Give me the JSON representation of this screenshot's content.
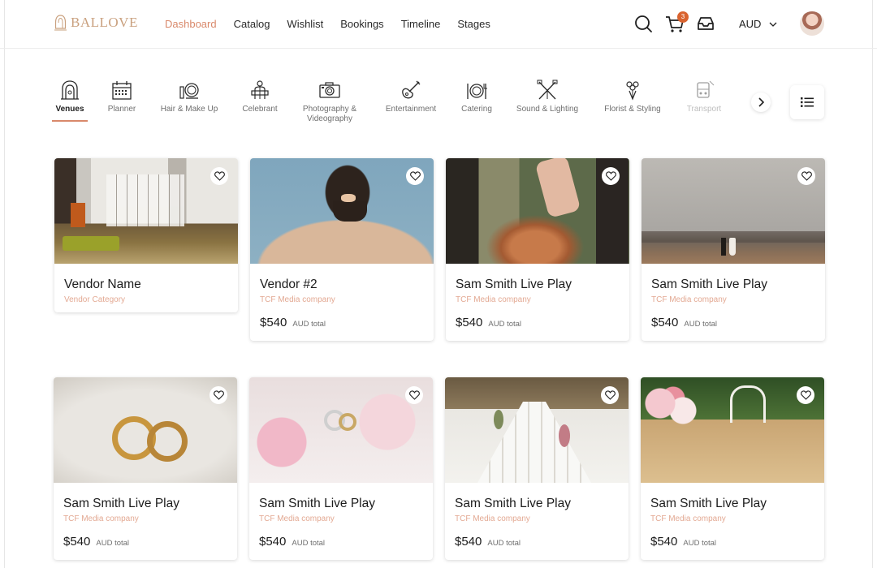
{
  "brand": {
    "name": "BALLOVE",
    "color": "#c9a07e",
    "accent": "#d9896b"
  },
  "nav": [
    {
      "label": "Dashboard",
      "active": true
    },
    {
      "label": "Catalog"
    },
    {
      "label": "Wishlist"
    },
    {
      "label": "Bookings"
    },
    {
      "label": "Timeline"
    },
    {
      "label": "Stages"
    }
  ],
  "header": {
    "cart_count": "3",
    "currency": "AUD"
  },
  "categories": [
    {
      "label": "Venues",
      "icon": "venue-arch-icon",
      "active": true
    },
    {
      "label": "Planner",
      "icon": "calendar-planner-icon"
    },
    {
      "label": "Hair & Make Up",
      "icon": "makeup-mirror-icon"
    },
    {
      "label": "Celebrant",
      "icon": "celebrant-icon"
    },
    {
      "label": "Photography &\nVideography",
      "icon": "camera-icon"
    },
    {
      "label": "Entertainment",
      "icon": "guitar-icon"
    },
    {
      "label": "Catering",
      "icon": "plate-cutlery-icon"
    },
    {
      "label": "Sound & Lighting",
      "icon": "lights-icon"
    },
    {
      "label": "Florist & Styling",
      "icon": "bouquet-icon"
    },
    {
      "label": "Transport",
      "icon": "transport-icon"
    }
  ],
  "cards": [
    {
      "title": "Vendor Name",
      "category": "Vendor Category",
      "price": "",
      "unit": ""
    },
    {
      "title": "Vendor #2",
      "category": "TCF Media company",
      "price": "$540",
      "unit": "AUD total"
    },
    {
      "title": "Sam Smith Live Play",
      "category": "TCF Media company",
      "price": "$540",
      "unit": "AUD total"
    },
    {
      "title": "Sam Smith Live Play",
      "category": "TCF Media company",
      "price": "$540",
      "unit": "AUD total"
    },
    {
      "title": "Sam Smith Live Play",
      "category": "TCF Media company",
      "price": "$540",
      "unit": "AUD total"
    },
    {
      "title": "Sam Smith Live Play",
      "category": "TCF Media company",
      "price": "$540",
      "unit": "AUD total"
    },
    {
      "title": "Sam Smith Live Play",
      "category": "TCF Media company",
      "price": "$540",
      "unit": "AUD total"
    },
    {
      "title": "Sam Smith Live Play",
      "category": "TCF Media company",
      "price": "$540",
      "unit": "AUD total"
    }
  ]
}
